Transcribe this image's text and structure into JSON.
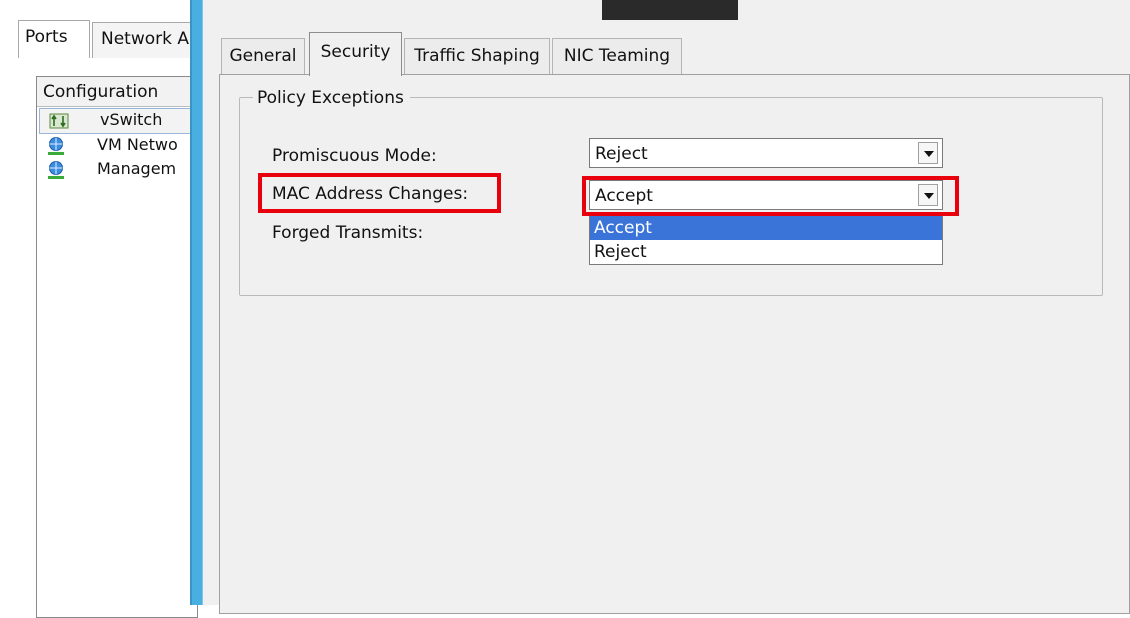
{
  "left_panel": {
    "tabs": [
      {
        "label": "Ports"
      },
      {
        "label": "Network A"
      }
    ],
    "list_header": "Configuration",
    "rows": [
      {
        "label": "vSwitch",
        "icon": "switch-icon"
      },
      {
        "label": "VM Netwo",
        "icon": "network-globe-icon"
      },
      {
        "label": "Managem",
        "icon": "network-globe-icon"
      }
    ]
  },
  "tabs": [
    {
      "label": "General"
    },
    {
      "label": "Security"
    },
    {
      "label": "Traffic Shaping"
    },
    {
      "label": "NIC Teaming"
    }
  ],
  "active_tab": "Security",
  "policy": {
    "legend": "Policy Exceptions",
    "promiscuous_label": "Promiscuous Mode:",
    "promiscuous_value": "Reject",
    "mac_label": "MAC Address Changes:",
    "mac_value": "Accept",
    "forged_label": "Forged Transmits:",
    "dropdown_options": [
      "Accept",
      "Reject"
    ]
  },
  "colors": {
    "highlight": "#e8000c",
    "selection": "#3a74d8",
    "divider": "#49aee0"
  }
}
